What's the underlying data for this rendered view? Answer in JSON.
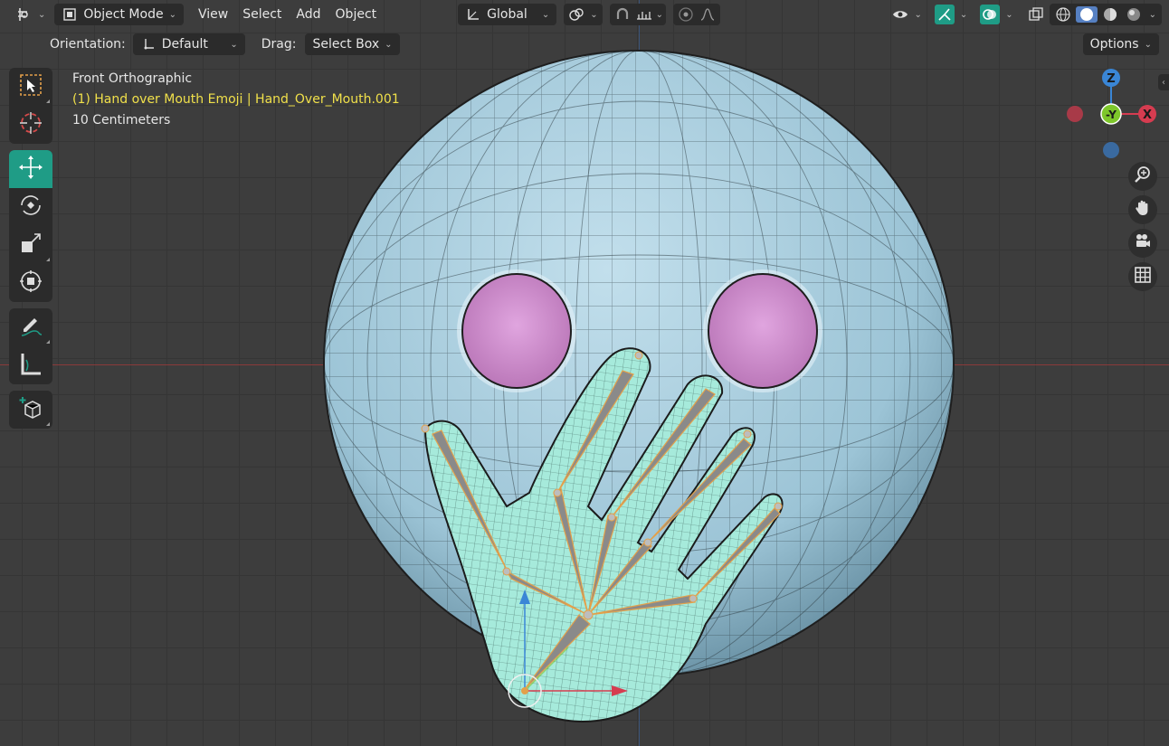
{
  "header": {
    "mode_label": "Object Mode",
    "menu": {
      "view": "View",
      "select": "Select",
      "add": "Add",
      "object": "Object"
    },
    "transform_orientation": "Global",
    "icons": [
      "editor-type-icon",
      "object-mode-icon",
      "transform-orientation-icon",
      "pivot-icon",
      "snap-icon",
      "snap-increment-icon",
      "proportional-edit-icon",
      "falloff-icon",
      "visibility-icon",
      "gizmo-icon",
      "overlay-icon",
      "xray-icon",
      "wireframe-shading-icon",
      "solid-shading-icon",
      "material-shading-icon",
      "rendered-shading-icon"
    ]
  },
  "tool_settings": {
    "orientation_label": "Orientation:",
    "orientation_value": "Default",
    "drag_label": "Drag:",
    "drag_value": "Select Box",
    "options_label": "Options"
  },
  "viewport_info": {
    "view_name": "Front Orthographic",
    "object_name": "(1) Hand over Mouth Emoji | Hand_Over_Mouth.001",
    "scale": "10 Centimeters"
  },
  "gizmo": {
    "z": "Z",
    "y": "-Y",
    "x": "X"
  },
  "colors": {
    "accent": "#1f9c86",
    "face": "#a9cfe0",
    "eyes": "#d48ed2",
    "hand": "#9ee6d4",
    "highlight_text": "#f0e04a",
    "axis_x": "#d63c50",
    "axis_y": "#7ec72b",
    "axis_z": "#3a86d6"
  }
}
